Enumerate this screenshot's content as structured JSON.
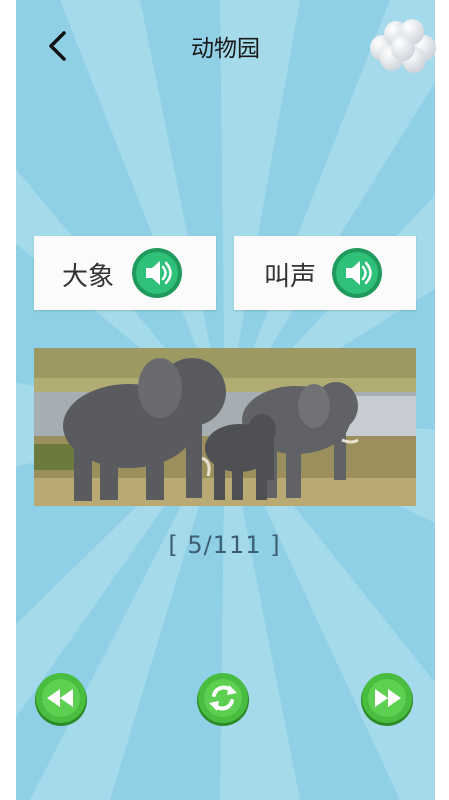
{
  "header": {
    "title": "动物园",
    "back_icon": "chevron-left-icon",
    "balloon_icon": "balloons-icon"
  },
  "cards": [
    {
      "word": "大象",
      "icon": "speaker-icon"
    },
    {
      "word": "叫声",
      "icon": "speaker-icon"
    }
  ],
  "image": {
    "subject": "elephants"
  },
  "counter": {
    "text": "[ 5/111 ]",
    "current": 5,
    "total": 111
  },
  "controls": {
    "prev_icon": "rewind-icon",
    "replay_icon": "replay-icon",
    "next_icon": "fast-forward-icon"
  },
  "colors": {
    "background": "#8fd0e6",
    "button_green": "#43b73c",
    "speaker_green": "#27b56f"
  }
}
